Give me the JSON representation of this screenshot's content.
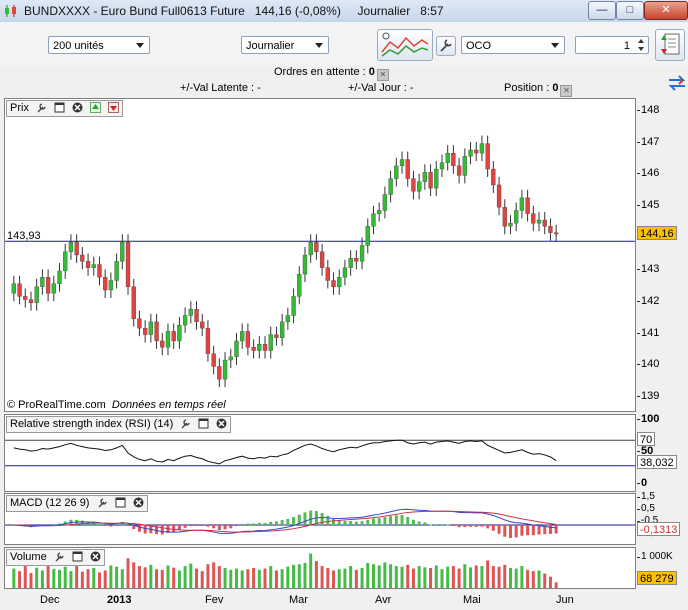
{
  "window": {
    "title": "BUNDXXXX - Euro Bund Full0613 Future",
    "price": "144,16 (-0,08%)",
    "period": "Journalier",
    "time": "8:57",
    "minimize": "—",
    "maximize": "□",
    "close": "✕"
  },
  "toolbar": {
    "quantity_select": "200 unités",
    "period_select": "Journalier",
    "order_type_select": "OCO",
    "quantity_stepper": "1"
  },
  "order_info": {
    "pending_label": "Ordres en attente :",
    "pending_value": "0",
    "latent_label": "+/-Val Latente :",
    "latent_value": "-",
    "day_label": "+/-Val Jour :",
    "day_value": "-",
    "position_label": "Position :",
    "position_value": "0"
  },
  "price_panel": {
    "label": "Prix",
    "axis_ticks": [
      "148",
      "147",
      "146",
      "145",
      "143",
      "142",
      "141",
      "140",
      "139"
    ],
    "current_price": "144,16",
    "ref_price": "143,93",
    "watermark_brand": "© ProRealTime.com",
    "watermark_note": "Données en temps réel",
    "colors": {
      "up": "#33bb33",
      "down": "#dd4444",
      "line": "#1a1a99",
      "badge": "#ffc000"
    }
  },
  "rsi_panel": {
    "label": "Relative strength index (RSI) (14)",
    "axis_ticks": [
      "100",
      "50",
      "0"
    ],
    "badge_70": "70",
    "current_value": "38,032"
  },
  "macd_panel": {
    "label": "MACD (12 26 9)",
    "axis_ticks": [
      "1,5",
      "0,5",
      "-0,5",
      "-1,5"
    ],
    "current_value": "-0,1313"
  },
  "volume_panel": {
    "label": "Volume",
    "axis_ticks": [
      "1 000K"
    ],
    "current_value": "68 279"
  },
  "x_axis": [
    "Dec",
    "2013",
    "Fev",
    "Mar",
    "Avr",
    "Mai",
    "Jun"
  ],
  "chart_data": {
    "type": "candlestick",
    "instrument": "BUNDXXXX - Euro Bund Full0613 Future",
    "ylim": [
      138.6,
      148.4
    ],
    "closes": [
      142.6,
      142.2,
      142.1,
      142.0,
      142.5,
      142.8,
      142.3,
      142.6,
      143.0,
      143.6,
      143.9,
      143.5,
      143.3,
      143.1,
      143.2,
      142.8,
      142.4,
      142.7,
      143.3,
      143.9,
      142.5,
      141.5,
      141.2,
      141.0,
      141.4,
      140.8,
      140.6,
      141.1,
      140.8,
      141.3,
      141.6,
      141.8,
      141.4,
      141.2,
      140.4,
      140.0,
      139.6,
      140.2,
      140.3,
      140.8,
      141.1,
      140.6,
      140.5,
      140.7,
      140.5,
      141.0,
      140.9,
      141.4,
      141.6,
      142.2,
      142.9,
      143.5,
      143.9,
      143.6,
      143.1,
      142.7,
      142.5,
      142.8,
      143.1,
      143.4,
      143.3,
      143.8,
      144.4,
      144.8,
      144.9,
      145.4,
      145.9,
      146.3,
      146.5,
      145.9,
      145.5,
      145.8,
      146.1,
      145.6,
      146.2,
      146.4,
      146.7,
      146.3,
      146.0,
      146.6,
      146.8,
      146.7,
      147.0,
      146.2,
      145.7,
      145.0,
      144.4,
      144.5,
      144.9,
      145.3,
      144.8,
      144.5,
      144.6,
      144.4,
      144.2,
      144.16
    ],
    "rsi_values": [
      58,
      56,
      55,
      53,
      54,
      57,
      56,
      58,
      60,
      63,
      65,
      62,
      60,
      58,
      57,
      56,
      54,
      55,
      58,
      62,
      50,
      44,
      40,
      38,
      41,
      37,
      36,
      40,
      38,
      42,
      45,
      46,
      43,
      41,
      37,
      35,
      33,
      38,
      40,
      43,
      45,
      42,
      41,
      43,
      42,
      45,
      44,
      47,
      49,
      54,
      58,
      62,
      64,
      61,
      57,
      54,
      52,
      55,
      57,
      59,
      58,
      61,
      64,
      66,
      66,
      68,
      69,
      70,
      70,
      66,
      64,
      66,
      67,
      64,
      67,
      68,
      69,
      67,
      65,
      68,
      69,
      68,
      69,
      62,
      58,
      54,
      50,
      51,
      53,
      55,
      51,
      48,
      49,
      47,
      44,
      38
    ],
    "rsi_levels": [
      70,
      30
    ],
    "macd_zero": 0,
    "volume_values": [
      620,
      540,
      700,
      480,
      650,
      560,
      720,
      610,
      580,
      680,
      540,
      700,
      520,
      600,
      640,
      500,
      560,
      720,
      680,
      600,
      950,
      820,
      700,
      660,
      740,
      600,
      580,
      720,
      650,
      560,
      700,
      780,
      620,
      540,
      760,
      820,
      700,
      640,
      580,
      620,
      560,
      600,
      640,
      580,
      620,
      700,
      560,
      600,
      680,
      740,
      760,
      800,
      1100,
      860,
      700,
      640,
      560,
      600,
      620,
      700,
      580,
      640,
      800,
      760,
      720,
      820,
      760,
      700,
      680,
      740,
      620,
      700,
      660,
      640,
      720,
      600,
      680,
      700,
      620,
      760,
      660,
      720,
      700,
      880,
      700,
      680,
      740,
      640,
      620,
      700,
      580,
      540,
      560,
      460,
      360,
      180
    ]
  }
}
